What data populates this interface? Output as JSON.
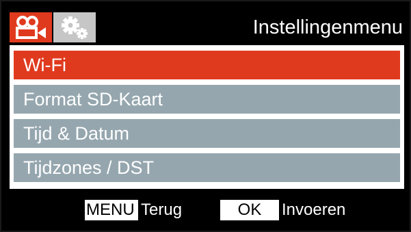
{
  "header": {
    "title": "Instellingenmenu",
    "tabs": [
      {
        "icon": "video-camera-icon",
        "active": true
      },
      {
        "icon": "gears-icon",
        "active": false
      }
    ]
  },
  "menu": {
    "items": [
      {
        "label": "Wi-Fi",
        "selected": true
      },
      {
        "label": "Format SD-Kaart",
        "selected": false
      },
      {
        "label": "Tijd & Datum",
        "selected": false
      },
      {
        "label": "Tijdzones / DST",
        "selected": false
      }
    ]
  },
  "footer": {
    "menu_key": "MENU",
    "menu_hint": "Terug",
    "ok_key": "OK",
    "ok_hint": "Invoeren"
  },
  "colors": {
    "accent": "#e03a1e",
    "item_bg": "#95a6ae",
    "tab_inactive": "#c6c6c6"
  }
}
